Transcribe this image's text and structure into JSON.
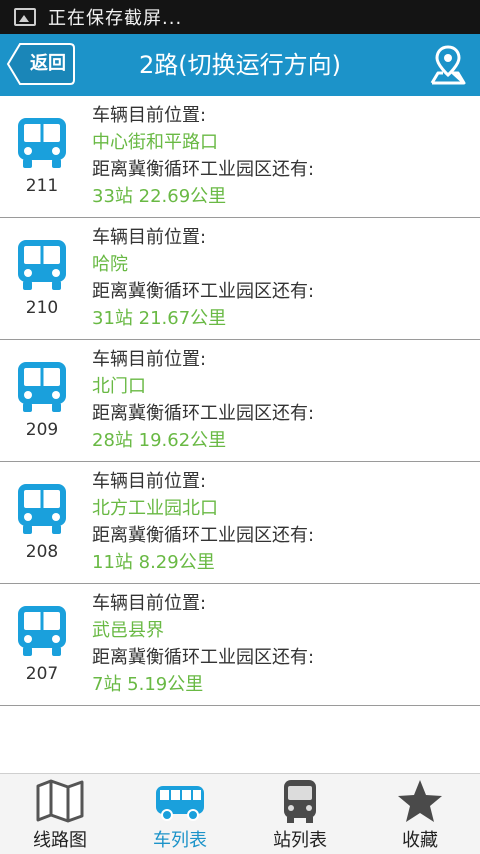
{
  "status_bar": {
    "notification_text": "正在保存截屏..."
  },
  "header": {
    "back_label": "返回",
    "title": "2路(切换运行方向)"
  },
  "vehicle_label": "车辆目前位置:",
  "distance_label": "距离冀衡循环工业园区还有:",
  "vehicles": [
    {
      "number": "211",
      "location": "中心街和平路口",
      "distance": "33站 22.69公里"
    },
    {
      "number": "210",
      "location": "哈院",
      "distance": "31站 21.67公里"
    },
    {
      "number": "209",
      "location": "北门口",
      "distance": "28站 19.62公里"
    },
    {
      "number": "208",
      "location": "北方工业园北口",
      "distance": "11站 8.29公里"
    },
    {
      "number": "207",
      "location": "武邑县界",
      "distance": "7站 5.19公里"
    }
  ],
  "tabs": [
    {
      "label": "线路图",
      "icon": "map-icon",
      "active": false
    },
    {
      "label": "车列表",
      "icon": "bus-side-icon",
      "active": true
    },
    {
      "label": "站列表",
      "icon": "bus-front-icon",
      "active": false
    },
    {
      "label": "收藏",
      "icon": "star-icon",
      "active": false
    }
  ],
  "colors": {
    "accent": "#1c93c9",
    "green_text": "#69b944",
    "bus_icon": "#1aa0dc"
  }
}
